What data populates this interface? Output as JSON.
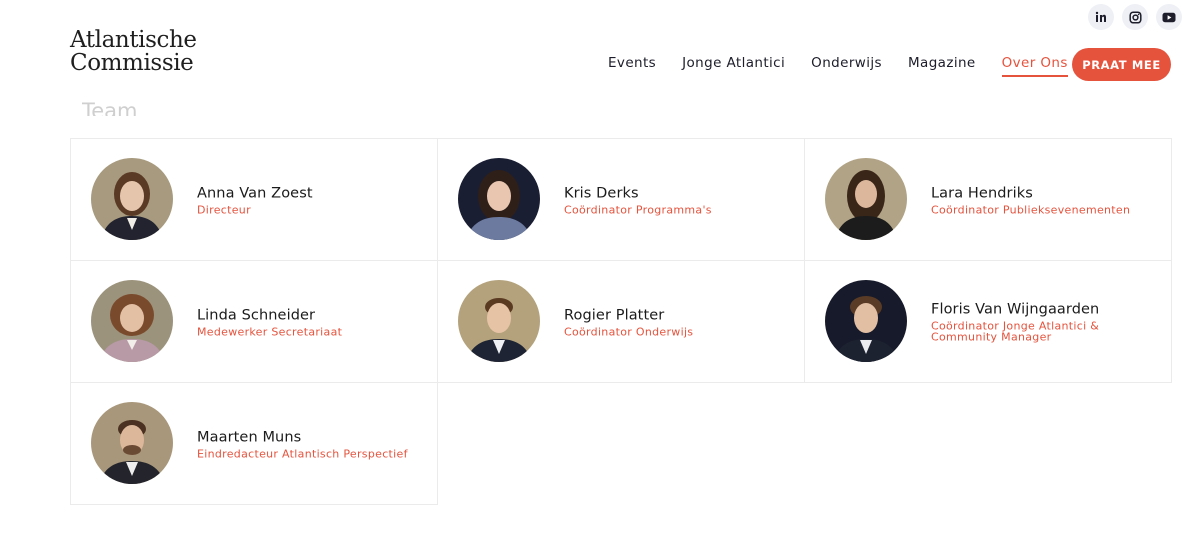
{
  "social": [
    {
      "name": "linkedin-icon",
      "label": "LinkedIn"
    },
    {
      "name": "instagram-icon",
      "label": "Instagram"
    },
    {
      "name": "youtube-icon",
      "label": "YouTube"
    }
  ],
  "logo": {
    "line1": "Atlantische",
    "line2": "Commissie"
  },
  "nav": {
    "items": [
      "Events",
      "Jonge Atlantici",
      "Onderwijs",
      "Magazine",
      "Over Ons"
    ],
    "active": "Over Ons",
    "cta": "PRAAT MEE"
  },
  "section_title": "Team",
  "colors": {
    "accent": "#e5533d",
    "border": "#ebebeb",
    "text": "#1b1b1b"
  },
  "team": [
    {
      "name": "Anna Van Zoest",
      "role": "Directeur"
    },
    {
      "name": "Kris Derks",
      "role": "Coördinator Programma's"
    },
    {
      "name": "Lara Hendriks",
      "role": "Coördinator Publieksevenementen"
    },
    {
      "name": "Linda Schneider",
      "role": "Medewerker Secretariaat"
    },
    {
      "name": "Rogier Platter",
      "role": "Coördinator Onderwijs"
    },
    {
      "name": "Floris Van Wijngaarden",
      "role": "Coördinator Jonge Atlantici & Community Manager"
    },
    {
      "name": "Maarten Muns",
      "role": "Eindredacteur Atlantisch Perspectief"
    }
  ]
}
